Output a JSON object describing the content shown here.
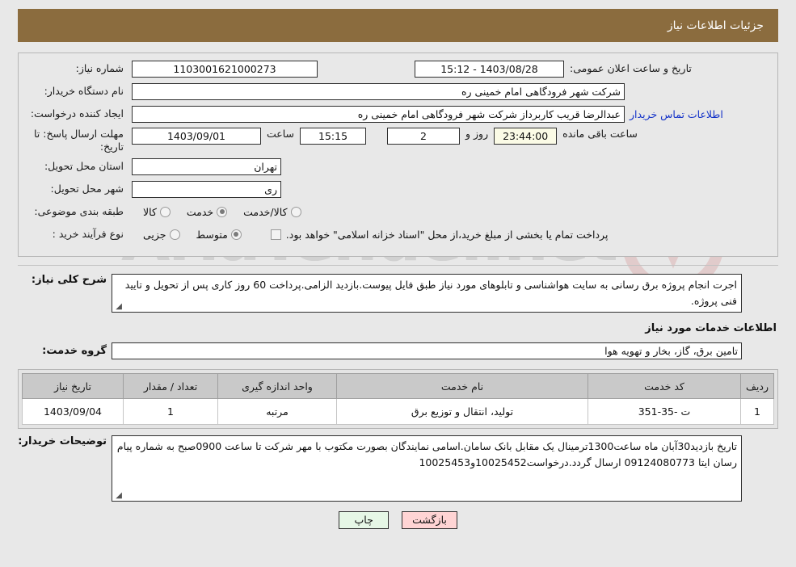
{
  "header": {
    "title": "جزئیات اطلاعات نیاز",
    "bar_color": "#8b6c3e"
  },
  "watermark": {
    "text": "AriaTender.net"
  },
  "details": {
    "need_number_label": "شماره نیاز:",
    "need_number_value": "1103001621000273",
    "announce_label": "تاریخ و ساعت اعلان عمومی:",
    "announce_value": "1403/08/28 - 15:12",
    "buyer_org_label": "نام دستگاه خریدار:",
    "buyer_org_value": "شرکت شهر فرودگاهی امام خمینی  ره",
    "requester_label": "ایجاد کننده درخواست:",
    "requester_value": "عبدالرضا قریب کاربرداز شرکت شهر فرودگاهی امام خمینی  ره",
    "contact_link": "اطلاعات تماس خریدار",
    "deadline_label_line1": "مهلت ارسال پاسخ: تا",
    "deadline_label_line2": "تاریخ:",
    "deadline_date": "1403/09/01",
    "hour_label": "ساعت",
    "deadline_time": "15:15",
    "days_remaining": "2",
    "days_label": "روز و",
    "countdown": "23:44:00",
    "countdown_label": "ساعت باقی مانده",
    "province_label": "استان محل تحویل:",
    "province_value": "تهران",
    "city_label": "شهر محل تحویل:",
    "city_value": "ری",
    "category_label": "طبقه بندی موضوعی:",
    "category_options": [
      {
        "label": "کالا",
        "selected": false
      },
      {
        "label": "خدمت",
        "selected": true
      },
      {
        "label": "کالا/خدمت",
        "selected": false
      }
    ],
    "process_label": "نوع فرآیند خرید :",
    "process_options": [
      {
        "label": "جزیی",
        "selected": false
      },
      {
        "label": "متوسط",
        "selected": true
      }
    ],
    "treasury_checkbox_label": "پرداخت تمام یا بخشی از مبلغ خرید،از محل \"اسناد خزانه اسلامی\" خواهد بود.",
    "treasury_checked": false
  },
  "description": {
    "label": "شرح کلی نیاز:",
    "value": "اجرت انجام پروژه برق رسانی به سایت هواشناسی و تابلوهای مورد نیاز طبق فایل پیوست.بازدید الزامی.پرداخت 60 روز کاری پس از تحویل و تایید فنی پروژه."
  },
  "services_section": {
    "heading": "اطلاعات خدمات مورد نیاز",
    "group_label": "گروه خدمت:",
    "group_value": "تامین برق، گاز، بخار و تهویه هوا"
  },
  "items_table": {
    "columns": [
      "ردیف",
      "کد خدمت",
      "نام خدمت",
      "واحد اندازه گیری",
      "تعداد / مقدار",
      "تاریخ نیاز"
    ],
    "rows": [
      {
        "index": "1",
        "code": "ت -35-351",
        "name": "تولید، انتقال و توزیع برق",
        "unit": "مرتبه",
        "quantity": "1",
        "date": "1403/09/04"
      }
    ]
  },
  "buyer_notes": {
    "label": "توضیحات خریدار:",
    "value": "تاریخ بازدید30آبان ماه ساعت1300ترمینال یک مقابل بانک سامان.اسامی نمایندگان بصورت مکتوب با مهر شرکت تا ساعت 0900صبح به شماره پیام رسان ایتا 09124080773 ارسال گردد.درخواست10025452و10025453"
  },
  "footer": {
    "back_label": "بازگشت",
    "print_label": "چاپ"
  }
}
